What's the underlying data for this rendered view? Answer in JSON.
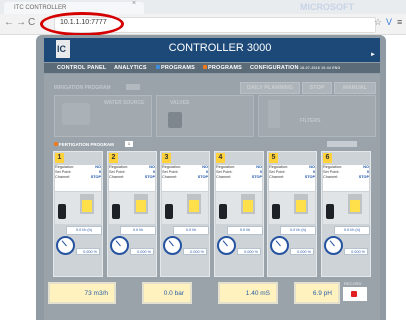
{
  "browser": {
    "tab_title": "ITC CONTROLLER",
    "faded_text": "MICROSOFT",
    "url": "10.1.1.10:7777"
  },
  "app": {
    "title": "CONTROLLER 3000",
    "logo_text": "IC",
    "menu": [
      "CONTROL PANEL",
      "ANALYTICS",
      "PROGRAMS",
      "PROGRAMS",
      "CONFIGURATION"
    ],
    "menu_colors": {
      "programs1": "#3d8fe0",
      "programs2": "#f07b1f"
    },
    "date_time": [
      "18-07-2016",
      "10:44",
      "ENG"
    ]
  },
  "panel": {
    "irrigation_label": "IRRIGATION PROGRAM",
    "buttons": [
      "DAILY PLANNING",
      "STOP",
      "MANUAL"
    ],
    "sublabels": [
      "WATER SOURCE",
      "VALVES",
      "FILTERS"
    ],
    "fertigation_label": "FERTIGATION PROGRAM",
    "fertigation_number": "1"
  },
  "channels": [
    {
      "num": "1",
      "regulation": "NO",
      "set_point": "0",
      "channel": "STOP",
      "flow": "0.0 l/h (h)",
      "percent": "0.000 %",
      "fill": 0.75
    },
    {
      "num": "2",
      "regulation": "NO",
      "set_point": "0",
      "channel": "STOP",
      "flow": "0.0 l/h",
      "percent": "0.000 %",
      "fill": 0.75
    },
    {
      "num": "3",
      "regulation": "NO",
      "set_point": "0",
      "channel": "STOP",
      "flow": "0.0 l/h",
      "percent": "0.000 %",
      "fill": 0.75
    },
    {
      "num": "4",
      "regulation": "NO",
      "set_point": "0",
      "channel": "STOP",
      "flow": "0.0 l/h",
      "percent": "0.000 %",
      "fill": 0.75
    },
    {
      "num": "5",
      "regulation": "NO",
      "set_point": "0",
      "channel": "STOP",
      "flow": "0.0 l/h (h)",
      "percent": "0.000 %",
      "fill": 0.75
    },
    {
      "num": "6",
      "regulation": "NO",
      "set_point": "0",
      "channel": "STOP",
      "flow": "0.0 l/h (h)",
      "percent": "0.000 %",
      "fill": 0.75
    }
  ],
  "channel_labels": {
    "regulation": "Regulation:",
    "set_point": "Set Point:",
    "channel": "Channel:"
  },
  "readouts": [
    "73 m3/h",
    "0.0 bar",
    "1.40 mS",
    "6.9 pH"
  ],
  "record_label": "RECORD"
}
